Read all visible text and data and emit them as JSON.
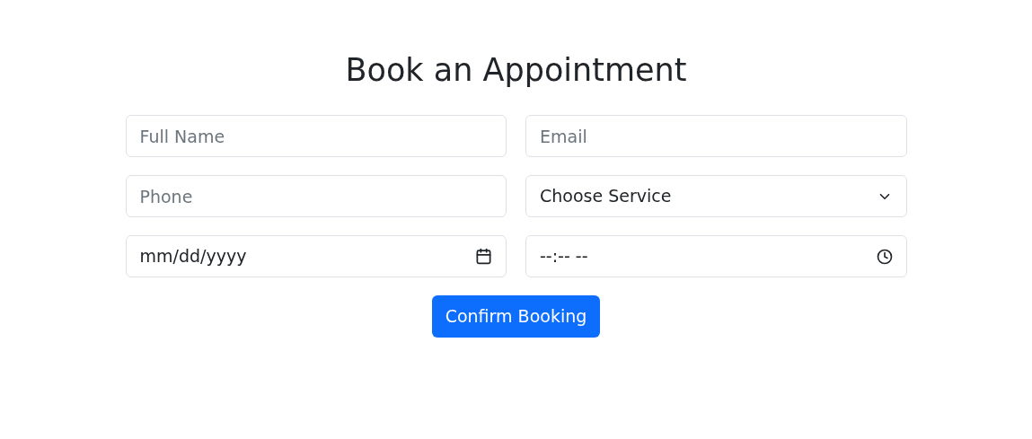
{
  "title": "Book an Appointment",
  "fields": [
    {
      "kind": "text",
      "placeholder": "Full Name"
    },
    {
      "kind": "text",
      "placeholder": "Email"
    },
    {
      "kind": "text",
      "placeholder": "Phone"
    },
    {
      "kind": "select",
      "value": "Choose Service"
    },
    {
      "kind": "date",
      "value": "mm/dd/yyyy"
    },
    {
      "kind": "time",
      "value": "--:-- --"
    }
  ],
  "submit": "Confirm Booking"
}
